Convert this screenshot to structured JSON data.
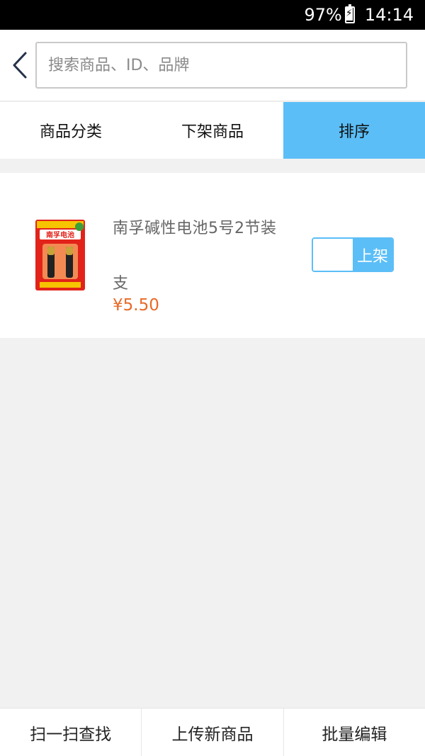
{
  "status_bar": {
    "battery": "97%",
    "time": "14:14"
  },
  "header": {
    "search_placeholder": "搜索商品、ID、品牌"
  },
  "tabs": [
    {
      "label": "商品分类",
      "active": false
    },
    {
      "label": "下架商品",
      "active": false
    },
    {
      "label": "排序",
      "active": true
    }
  ],
  "products": [
    {
      "name": "南孚碱性电池5号2节装",
      "unit": "支",
      "price": "¥5.50",
      "toggle_label": "上架",
      "image_brand": "南孚电池"
    }
  ],
  "bottom_bar": {
    "scan": "扫一扫查找",
    "upload": "上传新商品",
    "batch_edit": "批量编辑"
  },
  "colors": {
    "accent": "#5bbef7",
    "price": "#e86a26"
  }
}
